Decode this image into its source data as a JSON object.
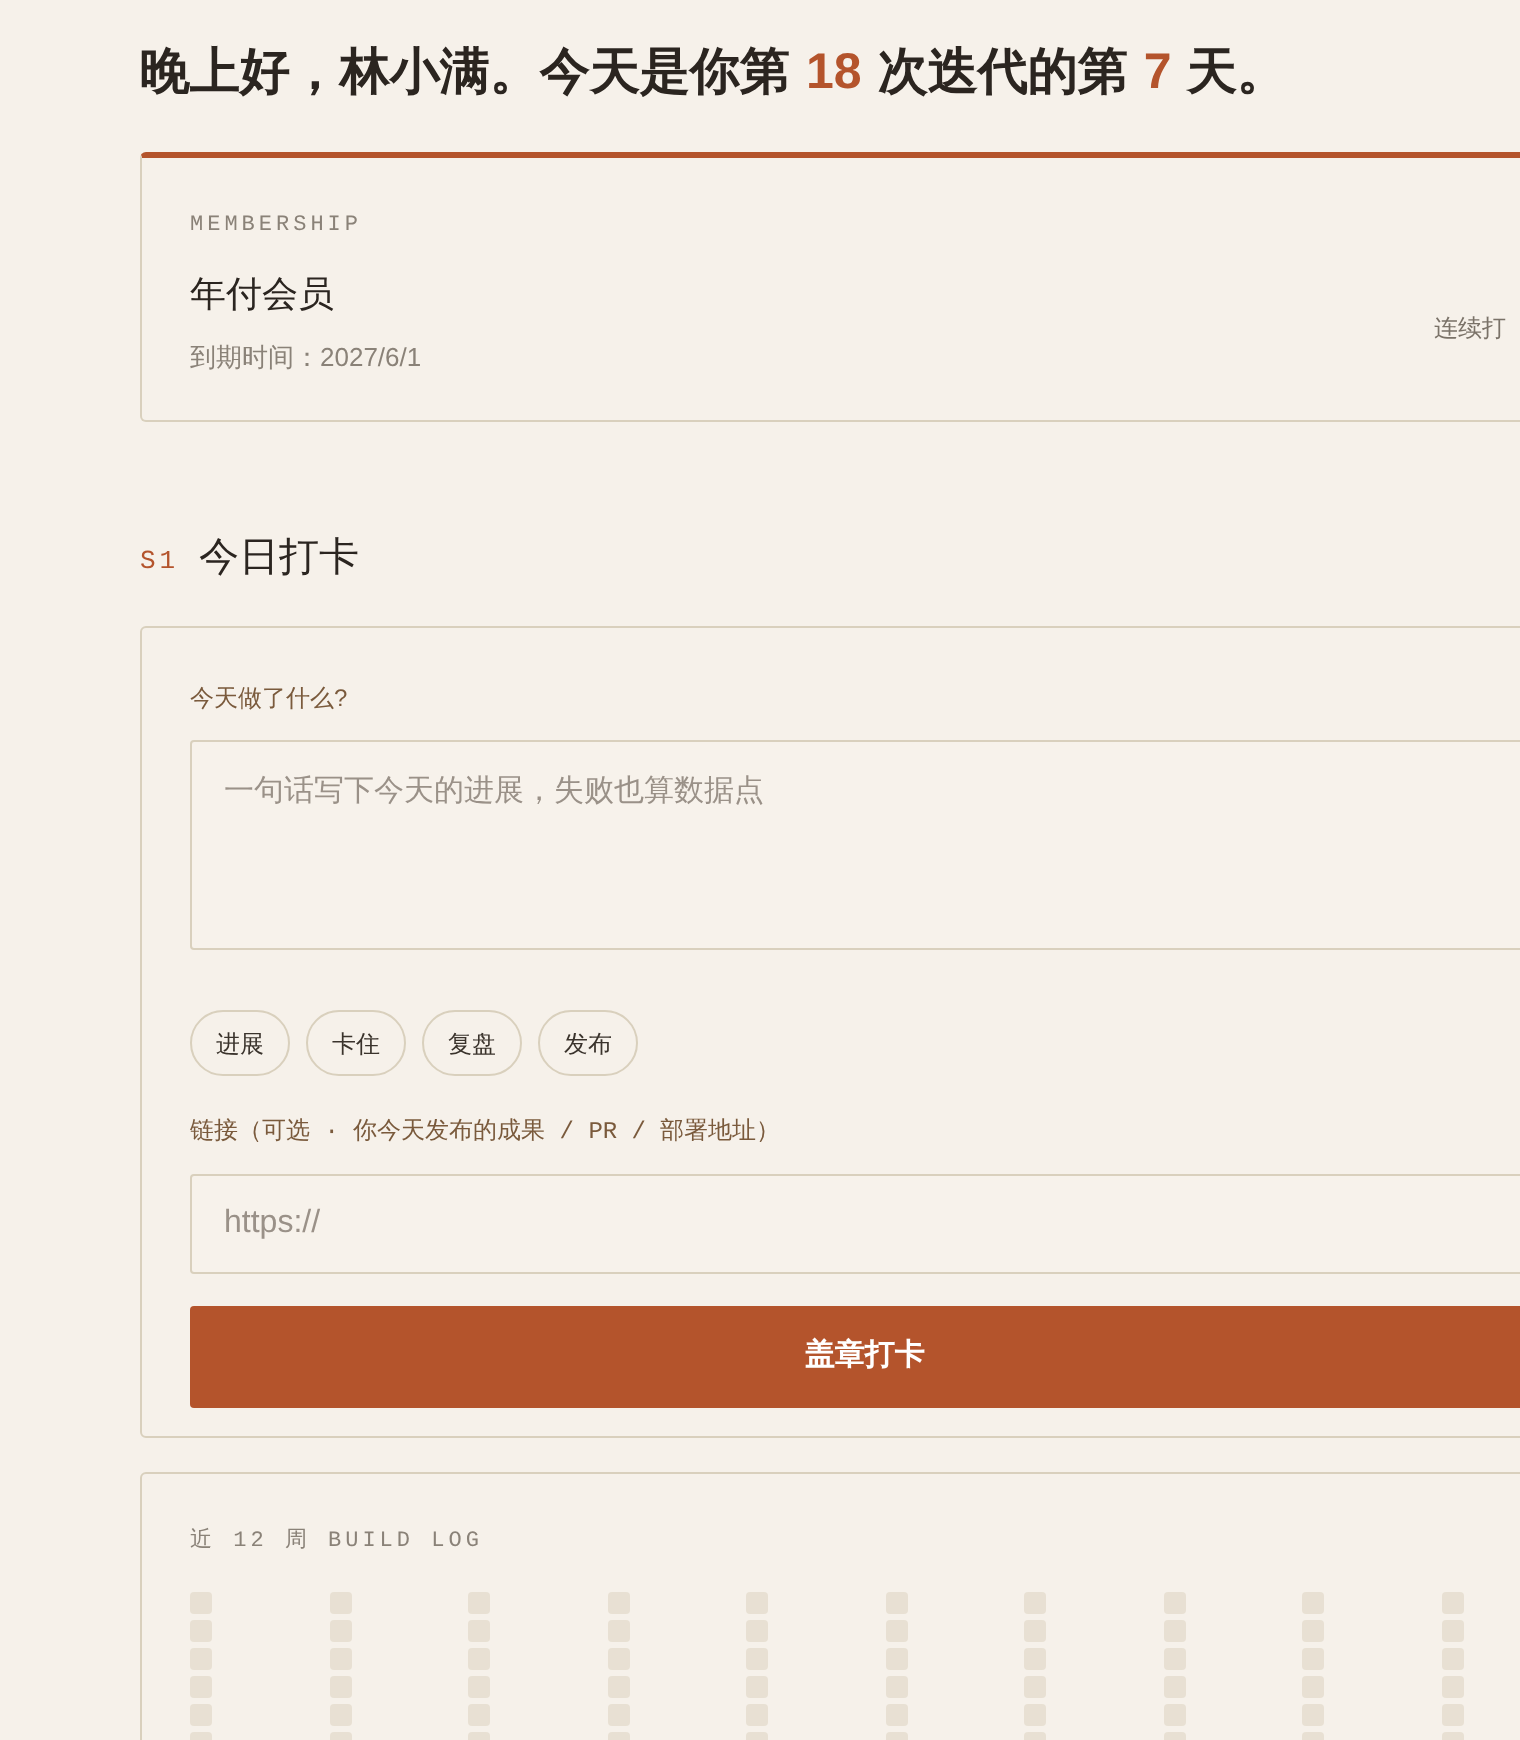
{
  "greeting": [
    {
      "kind": "text",
      "text": "晚上好，林小满。今天是你第"
    },
    {
      "kind": "number",
      "text": "18"
    },
    {
      "kind": "text",
      "text": "次迭代的第"
    },
    {
      "kind": "number",
      "text": "7"
    },
    {
      "kind": "text",
      "text": "天。"
    }
  ],
  "membership": {
    "eyebrow": "MEMBERSHIP",
    "plan": "年付会员",
    "expiry": "到期时间：2027/6/1",
    "streak_label": "连续打"
  },
  "checkin": {
    "section_number": "S1",
    "title": "今日打卡",
    "question": "今天做了什么?",
    "note_placeholder": "一句话写下今天的进展，失败也算数据点",
    "tags": [
      {
        "label": "进展",
        "selected": false
      },
      {
        "label": "卡住",
        "selected": false
      },
      {
        "label": "复盘",
        "selected": false
      },
      {
        "label": "发布",
        "selected": false
      }
    ],
    "link_label": "链接（可选 · 你今天发布的成果 / PR / 部署地址）",
    "link_placeholder": "https://",
    "submit": "盖章打卡"
  },
  "build_log": {
    "title": "近 12 周 BUILD LOG"
  }
}
